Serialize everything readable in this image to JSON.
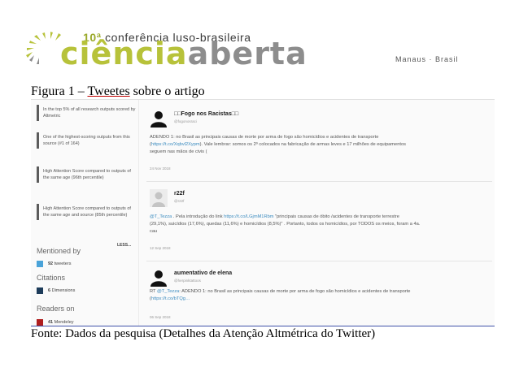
{
  "header": {
    "ordinal": "10ª",
    "conference": "conferência luso-brasileira",
    "brand_word1": "ciência",
    "brand_word2": "aberta",
    "city": "Manaus · Brasil",
    "colors": {
      "green": "#b7c23a",
      "gray": "#8d8d8d"
    }
  },
  "figure": {
    "title_prefix": "Figura 1 – ",
    "title_underlined": "Tweetes",
    "title_suffix": " sobre o artigo"
  },
  "sidebar": {
    "boxes": [
      {
        "text": "In the top 5% of all research outputs scored by Altmetric"
      },
      {
        "text": "One of the highest-scoring outputs from this source (#1 of 164)"
      },
      {
        "text": "High Attention Score compared to outputs of the same age (96th percentile)"
      },
      {
        "text": "High Attention Score compared to outputs of the same age and source (85th percentile)"
      }
    ],
    "less_label": "LESS...",
    "mentioned_by": {
      "heading": "Mentioned by",
      "count": "92",
      "label": "tweeters",
      "color": "#4aa3d9"
    },
    "citations": {
      "heading": "Citations",
      "count": "6",
      "label": "Dimensions",
      "color": "#1d3c5a"
    },
    "readers": {
      "heading": "Readers on",
      "count": "41",
      "label": "Mendeley",
      "color": "#b01e1e"
    }
  },
  "tweets": [
    {
      "name": "□□Fogo nos Racistas□□",
      "handle": "@fogonosraci",
      "body_lines": [
        [
          {
            "t": "ADENDO 1: no Brasil as principais causas de morte por arma de fogo são homicídios e acidentes de transporte"
          }
        ],
        [
          {
            "t": "(",
            "l": false
          },
          {
            "t": "https://t.co/Xqbvl2Xypm",
            "l": true
          },
          {
            "t": "). Vale lembrar: somos os 2º colocados na fabricação de armas leves e 17 milhões de equipamentos",
            "l": false
          }
        ],
        [
          {
            "t": "seguem nas mãos de civis ("
          }
        ]
      ],
      "date": "24 Nov 2018"
    },
    {
      "name": "r22f",
      "handle": "@r22f",
      "body_lines": [
        [
          {
            "t": "@T_Tezza",
            "l": true
          },
          {
            "t": " . Pela introdução do link ",
            "l": false
          },
          {
            "t": "https://t.co/LGjmM1Rbm",
            "l": true
          },
          {
            "t": " \"principais causas de óbito /acidentes de transporte terrestre",
            "l": false
          }
        ],
        [
          {
            "t": "(29,1%), suicídios (17,6%), quedas (11,6%) e homicídios (8,5%)\" . Portanto, todos os homicídios, por TODOS os meios, foram a 4a."
          }
        ],
        [
          {
            "t": "cau"
          }
        ]
      ],
      "date": "12 Sep 2018"
    },
    {
      "name": "aumentativo de elena",
      "handle": "@herpinktattoos",
      "body_lines": [
        [
          {
            "t": "RT ",
            "l": false
          },
          {
            "t": "@T_Tezza",
            "l": true
          },
          {
            "t": ": ADENDO 1: no Brasil as principais causas de morte por arma de fogo são homicídios e acidentes de transporte",
            "l": false
          }
        ],
        [
          {
            "t": "(",
            "l": false
          },
          {
            "t": "https://t.co/bTQg…",
            "l": true
          }
        ]
      ],
      "date": "06 Sep 2018"
    }
  ],
  "caption": "Fonte: Dados da pesquisa (Detalhes da Atenção Altmétrica do Twitter)"
}
